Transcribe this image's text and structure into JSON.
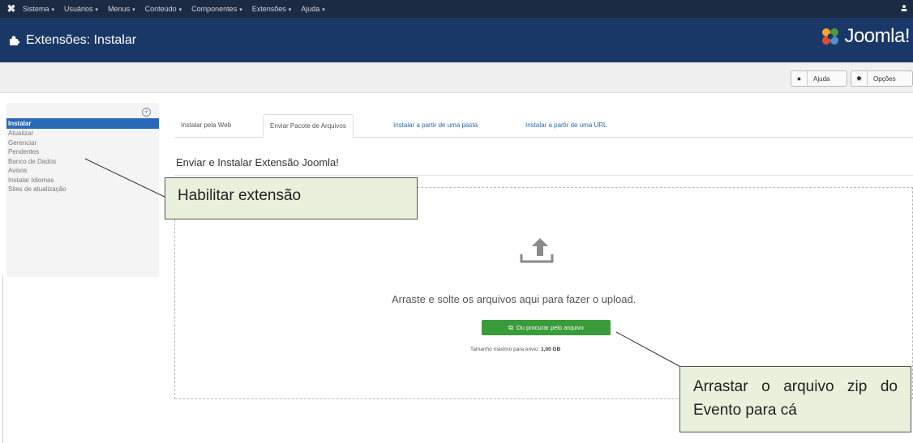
{
  "topnav": {
    "items": [
      {
        "label": "Sistema"
      },
      {
        "label": "Usuários"
      },
      {
        "label": "Menus"
      },
      {
        "label": "Conteúdo"
      },
      {
        "label": "Componentes"
      },
      {
        "label": "Extensões"
      },
      {
        "label": "Ajuda"
      }
    ],
    "caret": "▾",
    "user_icon": "user-icon"
  },
  "header": {
    "title": "Extensões: Instalar",
    "brand": "Joomla!"
  },
  "toolbar": {
    "help_label": "Ajuda",
    "options_label": "Opções"
  },
  "sidebar": {
    "items": [
      {
        "label": "Instalar",
        "active": true
      },
      {
        "label": "Atualizar"
      },
      {
        "label": "Gerenciar"
      },
      {
        "label": "Pendentes"
      },
      {
        "label": "Banco de Dados"
      },
      {
        "label": "Avisos"
      },
      {
        "label": "Instalar Idiomas"
      },
      {
        "label": "Sites de atualização"
      }
    ]
  },
  "tabs": [
    {
      "label": "Instalar pela Web"
    },
    {
      "label": "Enviar Pacote de Arquivos",
      "active": true
    },
    {
      "label": "Instalar a partir de uma pasta"
    },
    {
      "label": "Instalar a partir de uma URL"
    }
  ],
  "main": {
    "section_title": "Enviar e Instalar Extensão Joomla!",
    "drop_text": "Arraste e solte os arquivos aqui para fazer o upload.",
    "browse_label": "Ou procurar pelo arquivo",
    "max_size_label": "Tamanho máximo para envio:",
    "max_size_value": "1,00 GB"
  },
  "callouts": {
    "enable_extension": "Habilitar extensão",
    "drag_zip": "Arrastar o arquivo zip do Evento para cá"
  },
  "colors": {
    "topnav_bg": "#1c2b44",
    "header_bg": "#1a3867",
    "active_item": "#2a69b8",
    "browse_button": "#3a9b3a",
    "callout_bg": "#e9f0dc"
  }
}
